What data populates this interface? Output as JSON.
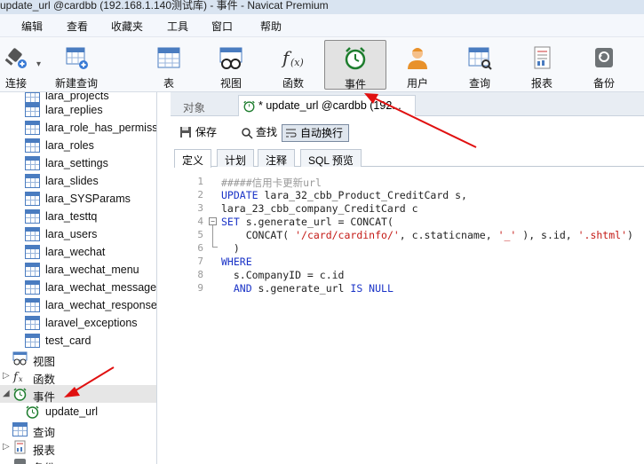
{
  "window": {
    "title": "update_url @cardbb (192.168.1.140测试库) - 事件 - Navicat Premium"
  },
  "menu": [
    "编辑",
    "查看",
    "收藏夹",
    "工具",
    "窗口",
    "帮助"
  ],
  "toolbar": {
    "connect": "连接",
    "new_query": "新建查询",
    "table": "表",
    "view": "视图",
    "function": "函数",
    "event": "事件",
    "user": "用户",
    "query": "查询",
    "report": "报表",
    "backup": "备份"
  },
  "tree": {
    "tables": [
      "lara_projects",
      "lara_replies",
      "lara_role_has_permiss",
      "lara_roles",
      "lara_settings",
      "lara_slides",
      "lara_SYSParams",
      "lara_testtq",
      "lara_users",
      "lara_wechat",
      "lara_wechat_menu",
      "lara_wechat_message",
      "lara_wechat_response",
      "laravel_exceptions",
      "test_card"
    ],
    "view": "视图",
    "function": "函数",
    "event": "事件",
    "event_item": "update_url",
    "query": "查询",
    "report": "报表",
    "backup": "备份"
  },
  "tabs": {
    "object": "对象",
    "editor": "* update_url @cardbb (192..."
  },
  "editor_toolbar": {
    "save": "保存",
    "find": "查找",
    "wrap": "自动换行"
  },
  "subtabs": [
    "定义",
    "计划",
    "注释",
    "SQL 预览"
  ],
  "code": {
    "numbers": [
      "1",
      "2",
      "3",
      "4",
      "5",
      "6",
      "7",
      "8",
      "9"
    ],
    "l1": "#####信用卡更新url",
    "l2a": "UPDATE",
    "l2b": " lara_32_cbb_Product_CreditCard s,",
    "l3": "lara_23_cbb_company_CreditCard c",
    "l4a": "SET",
    "l4b": " s.generate_url = CONCAT(",
    "l5a": "    CONCAT( ",
    "l5b": "'/card/cardinfo/'",
    "l5c": ", c.staticname, ",
    "l5d": "'_'",
    "l5e": " ), s.id, ",
    "l5f": "'.shtml'",
    "l5g": ")",
    "l6": "  )",
    "l7": "WHERE",
    "l8": "  s.CompanyID = c.id",
    "l9a": "  AND",
    "l9b": " s.generate_url ",
    "l9c": "IS NULL"
  },
  "colors": {
    "accent": "#4a7cc0",
    "annotation": "#e01010",
    "keyword": "#1a33c7",
    "string": "#c41a16"
  }
}
